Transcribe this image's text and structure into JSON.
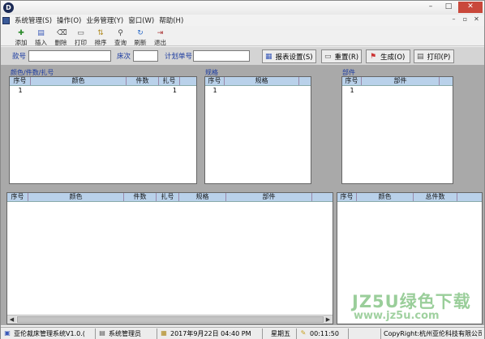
{
  "window": {
    "app_icon": "D",
    "controls": [
      "–",
      "□",
      "✕"
    ]
  },
  "menubar": {
    "items": [
      "系统管理(S)",
      "操作(O)",
      "业务管理(Y)",
      "窗口(W)",
      "帮助(H)"
    ],
    "mdi_controls": [
      "–",
      "▫",
      "✕"
    ]
  },
  "toolbar": {
    "buttons": [
      {
        "label": "添加",
        "icon": "add-icon"
      },
      {
        "label": "插入",
        "icon": "insert-icon"
      },
      {
        "label": "删除",
        "icon": "delete-icon"
      },
      {
        "label": "打印",
        "icon": "print-icon"
      },
      {
        "label": "排序",
        "icon": "sort-icon"
      },
      {
        "label": "查询",
        "icon": "search-icon"
      },
      {
        "label": "刷新",
        "icon": "refresh-icon"
      },
      {
        "label": "退出",
        "icon": "exit-icon"
      }
    ]
  },
  "criteria": {
    "style_label": "款号",
    "style_value": "",
    "bed_label": "床次",
    "bed_value": "",
    "plan_label": "计划单号",
    "plan_value": "",
    "report_settings": "报表设置(S)",
    "reset": "重置(R)",
    "generate": "生成(O)",
    "print": "打印(P)"
  },
  "panels": {
    "color": {
      "title": "颜色/件数/扎号",
      "headers": [
        "序号",
        "颜色",
        "件数",
        "扎号"
      ],
      "rows": [
        [
          "1",
          "",
          "",
          "1"
        ]
      ]
    },
    "size": {
      "title": "规格",
      "headers": [
        "序号",
        "规格"
      ],
      "rows": [
        [
          "1",
          ""
        ]
      ]
    },
    "part": {
      "title": "部件",
      "headers": [
        "序号",
        "部件"
      ],
      "rows": [
        [
          "1",
          ""
        ]
      ]
    }
  },
  "bottom": {
    "left_headers": [
      "序号",
      "颜色",
      "件数",
      "扎号",
      "规格",
      "部件"
    ],
    "right_headers": [
      "序号",
      "颜色",
      "总件数"
    ]
  },
  "statusbar": {
    "system": "亚伦裁床管理系统V1.0.(",
    "user": "系统管理员",
    "datetime": "2017年9月22日 04:40 PM",
    "weekday": "星期五",
    "time": "00:11:50",
    "copyright": "CopyRight:杭州亚伦科技有限公司"
  },
  "watermark": {
    "line1": "JZ5U绿色下载",
    "line2": "www.jz5u.com"
  },
  "colors": {
    "label_blue": "#1a3aa0",
    "grid_header": "#b9d1ea",
    "work_area": "#a9a9a9"
  }
}
